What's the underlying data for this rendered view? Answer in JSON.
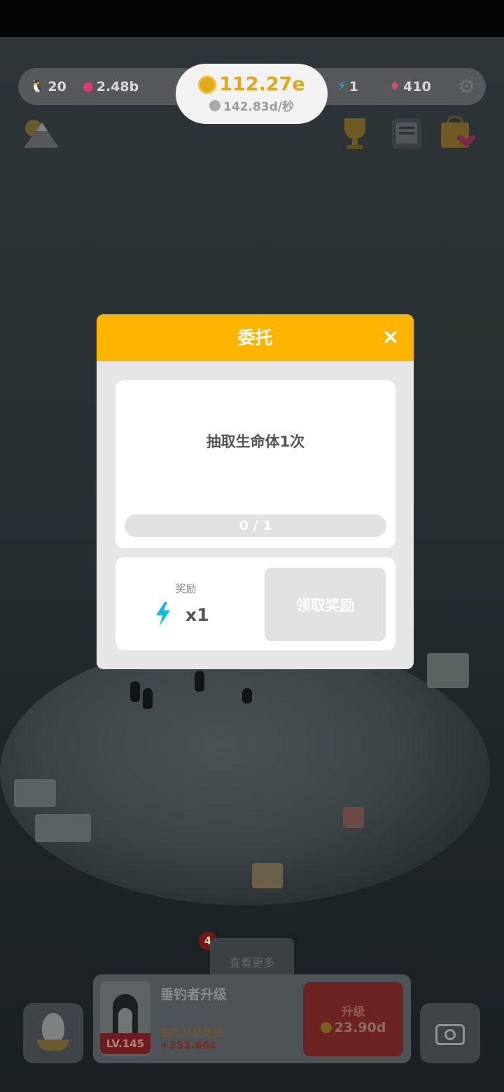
{
  "hud": {
    "population": "20",
    "pink_gems": "2.48b",
    "coins": "112.27e",
    "coin_rate": "142.83d/秒",
    "energy": "1",
    "diamonds": "410"
  },
  "icons": {
    "population": "penguin-icon",
    "pink_gems": "pink-gem-icon",
    "coins": "gold-coin-icon",
    "energy": "lightning-bolt-icon",
    "diamonds": "red-diamond-icon",
    "settings": "gear-icon",
    "map": "mountain-map-icon",
    "trophy": "trophy-icon",
    "quests": "clipboard-icon",
    "shop": "shop-bag-icon",
    "egg": "egg-icon",
    "camera": "camera-icon"
  },
  "modal": {
    "title": "委托",
    "close_symbol": "×",
    "task": "抽取生命体1次",
    "progress_text": "0 / 1",
    "progress_value": 0,
    "progress_total": 1,
    "reward_label": "奖励",
    "reward_quantity": "x1",
    "claim_label": "领取奖励"
  },
  "bottom": {
    "see_more": "查看更多",
    "badge_count": "4",
    "upgrade_title": "垂钓者升级",
    "upgrade_level": "LV.145",
    "upgrade_desc": "金币产量增加",
    "upgrade_bonus": "+352.66c",
    "upgrade_button_label": "升级",
    "upgrade_cost": "23.90d"
  },
  "colors": {
    "modal_header": "#ffb400",
    "energy_blue": "#1ab7e8",
    "coin_gold": "#e0a81a",
    "pink_gem": "#e0387a"
  }
}
